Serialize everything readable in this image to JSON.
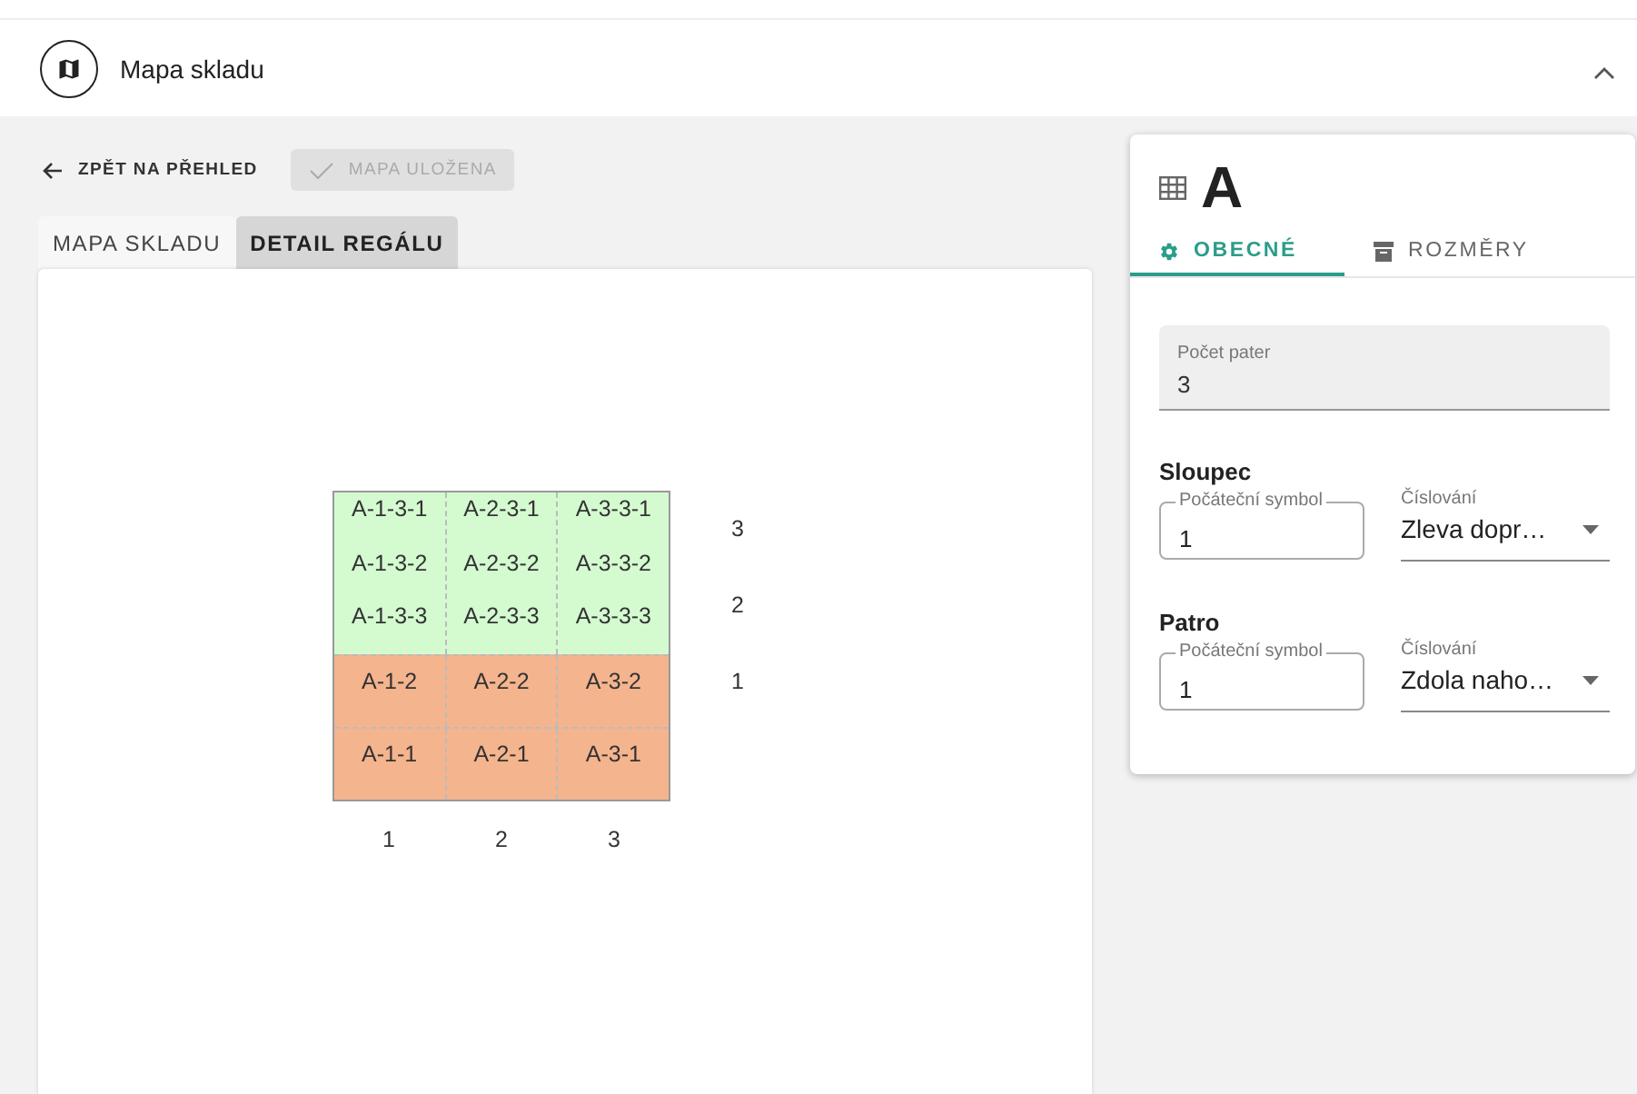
{
  "header": {
    "title": "Mapa skladu",
    "expanded": true
  },
  "toolbar": {
    "back": "ZPĚT NA PŘEHLED",
    "save": {
      "label": "MAPA ULOŽENA",
      "disabled": true
    }
  },
  "tabs": [
    {
      "label": "MAPA SKLADU",
      "selected": false
    },
    {
      "label": "DETAIL REGÁLU",
      "selected": true
    }
  ],
  "rack": {
    "levels": [
      {
        "color": "#d4fbd0",
        "kind": "multi",
        "columns": [
          [
            "A-1-3-1",
            "A-1-3-2",
            "A-1-3-3"
          ],
          [
            "A-2-3-1",
            "A-2-3-2",
            "A-2-3-3"
          ],
          [
            "A-3-3-1",
            "A-3-3-2",
            "A-3-3-3"
          ]
        ]
      },
      {
        "color": "#f4b48e",
        "kind": "single",
        "columns": [
          [
            "A-1-2"
          ],
          [
            "A-2-2"
          ],
          [
            "A-3-2"
          ]
        ]
      },
      {
        "color": "#f4b48e",
        "kind": "single",
        "columns": [
          [
            "A-1-1"
          ],
          [
            "A-2-1"
          ],
          [
            "A-3-1"
          ]
        ]
      }
    ],
    "row_labels": [
      "3",
      "2",
      "1"
    ],
    "column_labels": [
      "1",
      "2",
      "3"
    ]
  },
  "detail": {
    "title": "A",
    "tabs": [
      {
        "label": "OBECNÉ",
        "kind": "gear",
        "selected": true
      },
      {
        "label": "ROZMĚRY",
        "kind": "archive",
        "selected": false
      }
    ],
    "level_count": {
      "label": "Počet pater",
      "value": "3"
    },
    "sections": [
      {
        "title": "Sloupec",
        "start": {
          "label": "Počáteční symbol",
          "value": "1"
        },
        "numbering": {
          "label": "Číslování",
          "value": "Zleva dopr…"
        }
      },
      {
        "title": "Patro",
        "start": {
          "label": "Počáteční symbol",
          "value": "1"
        },
        "numbering": {
          "label": "Číslování",
          "value": "Zdola naho…"
        }
      }
    ]
  }
}
